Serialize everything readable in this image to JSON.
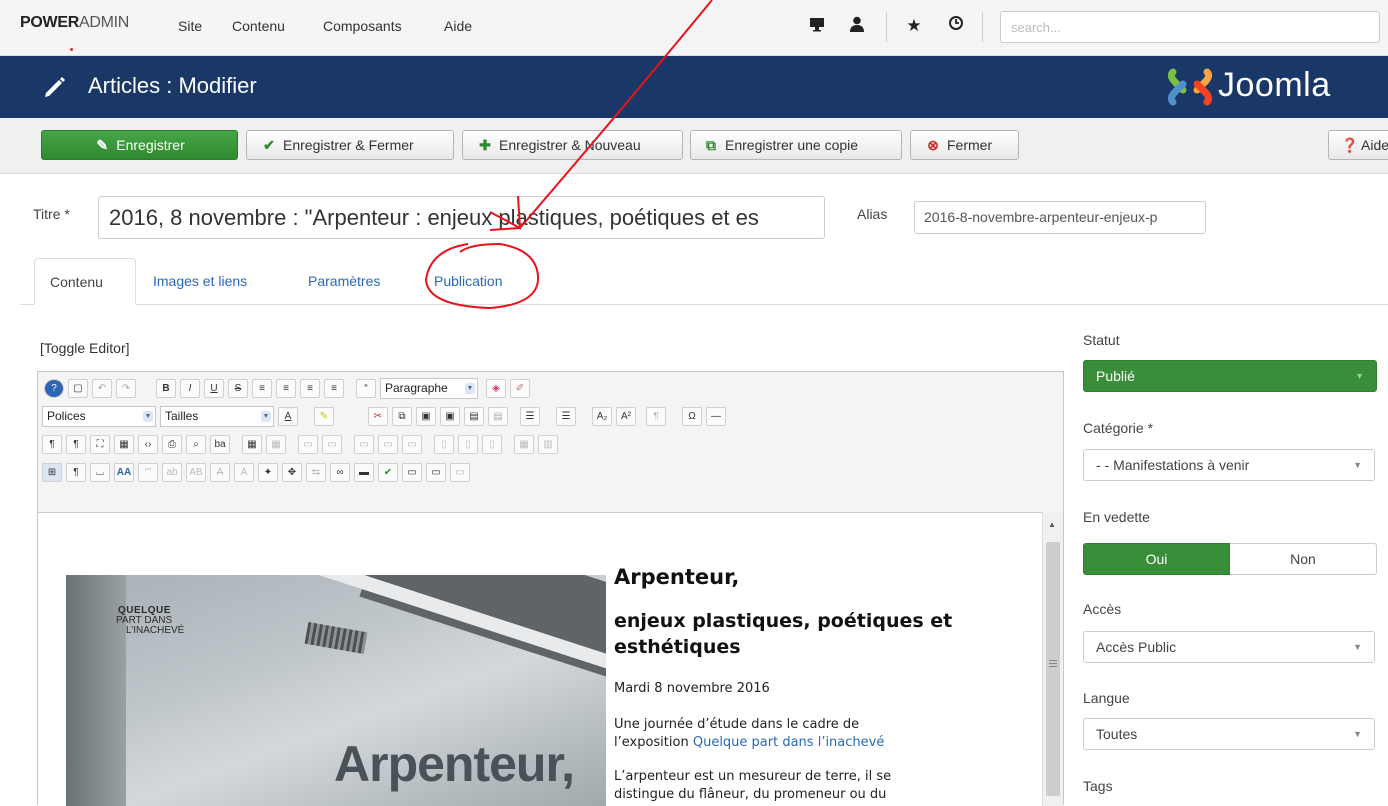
{
  "topbar": {
    "brand_bold": "POWER",
    "brand_rest": "ADMIN",
    "menu": [
      "Site",
      "Contenu",
      "Composants",
      "Aide"
    ],
    "icons": [
      "monitor-icon",
      "user-icon",
      "star-icon",
      "clock-icon"
    ],
    "search_placeholder": "search..."
  },
  "header": {
    "title": "Articles : Modifier",
    "logo_text": "Joomla"
  },
  "toolbar": {
    "save": "Enregistrer",
    "save_close": "Enregistrer & Fermer",
    "save_new": "Enregistrer & Nouveau",
    "save_copy": "Enregistrer une copie",
    "close": "Fermer",
    "help": "Aide"
  },
  "form": {
    "title_label": "Titre *",
    "title_value": "2016, 8 novembre : \"Arpenteur : enjeux plastiques, poétiques et es",
    "alias_label": "Alias",
    "alias_value": "2016-8-novembre-arpenteur-enjeux-p"
  },
  "tabs": [
    "Contenu",
    "Images et liens",
    "Paramètres",
    "Publication"
  ],
  "editor": {
    "toggle": "[Toggle Editor]",
    "format_select": "Paragraphe",
    "font_select": "Polices",
    "size_select": "Tailles"
  },
  "article": {
    "heading": "Arpenteur,",
    "subheading": "enjeux plastiques, poétiques et esthétiques",
    "date": "Mardi 8 novembre 2016",
    "intro": "Une journée d’étude dans le cadre de",
    "intro2_prefix": "l’exposition ",
    "intro2_link": "Quelque part dans l’inachevé",
    "body1": "L’arpenteur est un mesureur de terre, il se",
    "body2": "distingue du flâneur, du promeneur ou du",
    "image_text_1": "QUELQUE",
    "image_text_2": "PART DANS",
    "image_text_3": "L’INACHEVÉ",
    "image_big": "Arpenteur,"
  },
  "sidebar": {
    "status_label": "Statut",
    "status_value": "Publié",
    "category_label": "Catégorie *",
    "category_value": "- - Manifestations à venir",
    "featured_label": "En vedette",
    "featured_yes": "Oui",
    "featured_no": "Non",
    "access_label": "Accès",
    "access_value": "Accès Public",
    "language_label": "Langue",
    "language_value": "Toutes",
    "tags_label": "Tags"
  },
  "colors": {
    "header_bg": "#1a3867",
    "green": "#3a8e3a",
    "link": "#2a69b8",
    "annotation": "#e8131b"
  }
}
